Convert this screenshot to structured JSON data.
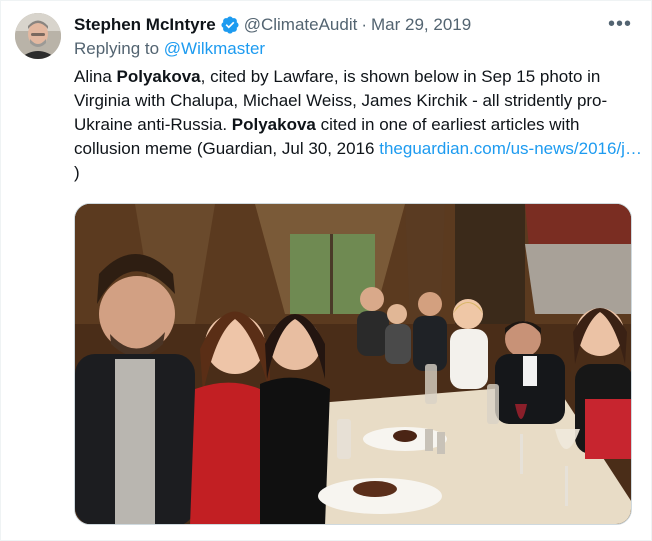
{
  "author": {
    "name": "Stephen McIntyre",
    "handle": "@ClimateAudit",
    "separator": "·",
    "date": "Mar 29, 2019",
    "verified_icon": "verified-badge-icon",
    "avatar_icon": "avatar"
  },
  "more_button": {
    "label": "•••",
    "icon": "more-options-icon"
  },
  "reply": {
    "prefix": "Replying to ",
    "target": "@Wilkmaster"
  },
  "tweet": {
    "p1": "Alina ",
    "b1": "Polyakova",
    "p2": ", cited by Lawfare, is shown below in Sep 15 photo in Virginia with Chalupa, Michael Weiss, James Kirchik - all stridently pro-Ukraine anti-Russia. ",
    "b2": "Polyakova",
    "p3": " cited in one of earliest articles with collusion meme (Guardian, Jul 30, 2016 ",
    "link": "theguardian.com/us-news/2016/j…",
    "p4": " )"
  },
  "media": {
    "type": "photo",
    "icon": "attached-photo"
  },
  "colors": {
    "link": "#1d9bf0",
    "secondary_text": "#536471",
    "primary_text": "#0f1419",
    "verified": "#1d9bf0"
  }
}
